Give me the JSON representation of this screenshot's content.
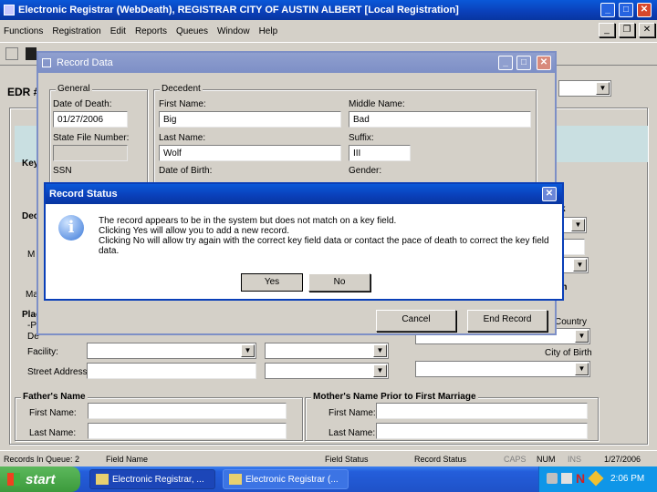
{
  "main_window": {
    "title": "Electronic Registrar (WebDeath), REGISTRAR   CITY OF AUSTIN   ALBERT   [Local Registration]",
    "menu": [
      "Functions",
      "Registration",
      "Edit",
      "Reports",
      "Queues",
      "Window",
      "Help"
    ],
    "edr_label": "EDR #"
  },
  "background_form": {
    "key_group": "Key",
    "dec_group": "Dec",
    "place_group": "Place",
    "side_labels": [
      "M",
      "Ma",
      "-P",
      "De"
    ],
    "facility_label": "Facility:",
    "street_label": "Street Address:",
    "right_labels": [
      "k",
      "th",
      "Country",
      "City of Birth"
    ],
    "fathers_name": "Father's Name",
    "father_first": "First Name:",
    "father_last": "Last Name:",
    "mothers_name": "Mother's Name Prior to First Marriage",
    "mother_first": "First Name:",
    "mother_last": "Last Name:"
  },
  "record_data": {
    "title": "Record Data",
    "general_group": "General",
    "date_of_death_label": "Date of Death:",
    "date_of_death_value": "01/27/2006",
    "state_file_label": "State File Number:",
    "ssn_label": "SSN",
    "decedent_group": "Decedent",
    "first_name_label": "First Name:",
    "first_name_value": "Big",
    "middle_name_label": "Middle Name:",
    "middle_name_value": "Bad",
    "last_name_label": "Last Name:",
    "last_name_value": "Wolf",
    "suffix_label": "Suffix:",
    "suffix_value": "III",
    "dob_label": "Date of Birth:",
    "gender_label": "Gender:",
    "cancel_label": "Cancel",
    "end_record_label": "End Record"
  },
  "record_status": {
    "title": "Record Status",
    "line1": "The record appears to be in the system but does not match on a key field.",
    "line2": "Clicking Yes will allow you to add a new record.",
    "line3": "Clicking No will allow try again with the correct key field data or contact the pace of death to correct the key field",
    "line4": "data.",
    "yes_label": "Yes",
    "no_label": "No"
  },
  "status_bar": {
    "queue": "Records In Queue: 2",
    "field_name": "Field Name",
    "field_status": "Field Status",
    "record_status": "Record Status",
    "caps": "CAPS",
    "num": "NUM",
    "ins": "INS",
    "date": "1/27/2006"
  },
  "taskbar": {
    "start_label": "start",
    "task1": "Electronic Registrar, ...",
    "task2": "Electronic Registrar (...",
    "clock": "2:06 PM"
  },
  "colors": {
    "title_blue": "#0a3fb8",
    "taskbar_blue": "#245edb",
    "start_green": "#3c9a3c",
    "face": "#d4d0c8"
  }
}
